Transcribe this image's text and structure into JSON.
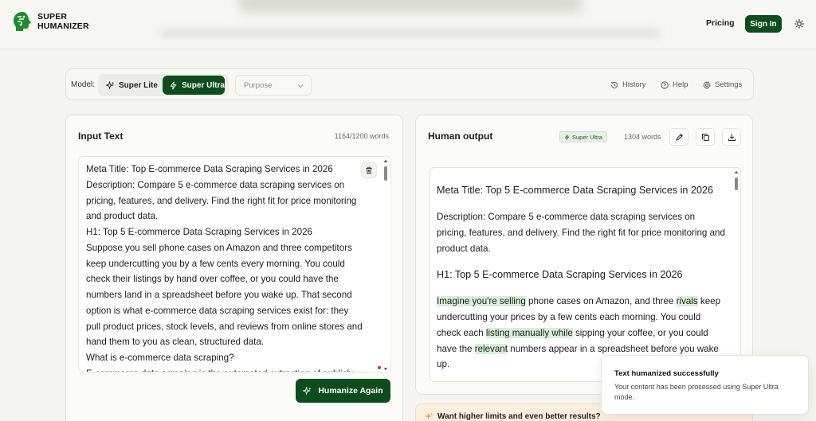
{
  "brand": {
    "line1": "SUPER",
    "line2": "HUMANIZER"
  },
  "nav": {
    "pricing": "Pricing",
    "signin": "Sign In"
  },
  "model_bar": {
    "label": "Model:",
    "options": [
      "Super Lite",
      "Super Ultra"
    ],
    "selected": "Super Ultra",
    "purpose_placeholder": "Purpose",
    "tools": {
      "history": "History",
      "help": "Help",
      "settings": "Settings"
    }
  },
  "input_panel": {
    "title": "Input Text",
    "word_count": "1164/1200 words",
    "lines": [
      "Meta Title: Top E-commerce Data Scraping Services in 2026",
      "Description: Compare 5 e-commerce data scraping services on",
      "pricing, features, and delivery. Find the right fit for price monitoring",
      "and product data.",
      "H1: Top 5 E-commerce Data Scraping Services in 2026",
      "Suppose you sell phone cases on Amazon and three competitors",
      "keep undercutting you by a few cents every morning. You could",
      "check their listings by hand over coffee, or you could have the",
      "numbers land in a spreadsheet before you wake up. That second",
      "option is what e-commerce data scraping services exist for: they",
      "pull product prices, stock levels, and reviews from online stores and",
      "hand them to you as clean, structured data.",
      "What is e-commerce data scraping?",
      "E-commerce data scraping is the automated extraction of publicly"
    ],
    "humanize_button": "Humanize Again"
  },
  "output_panel": {
    "title": "Human output",
    "badge": "Super Ultra",
    "word_count": "1304 words",
    "meta_title": "Meta Title: Top 5 E-commerce Data Scraping Services in 2026",
    "description": "Description: Compare 5 e-commerce data scraping services on pricing, features, and delivery.  Find the right fit for price monitoring and product data.",
    "h1": "H1: Top 5 E-commerce Data Scraping Services in 2026",
    "para": {
      "s1": "Imagine you're selling",
      "s2": " phone cases on Amazon, and three ",
      "s3": "rivals",
      "s4": " keep undercutting your prices by a few cents each morning.  You could check each ",
      "s5": "listing manually while",
      "s6": " sipping your coffee, or you could have the ",
      "s7": "relevant",
      "s8": " numbers appear in a spreadsheet before you wake up."
    }
  },
  "promo": {
    "text": "Want higher limits and even better results?"
  },
  "toast": {
    "title": "Text humanized successfully",
    "body": "Your content has been processed using Super Ultra mode."
  },
  "colors": {
    "brand_green": "#0d4d1d",
    "highlight": "#d7f0d8"
  }
}
